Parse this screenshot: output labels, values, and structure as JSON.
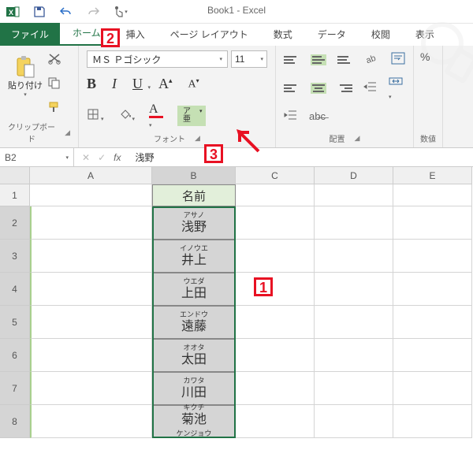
{
  "app": {
    "title": "Book1 - Excel"
  },
  "tabs": {
    "file": "ファイル",
    "home": "ホーム",
    "insert": "挿入",
    "pagelayout": "ページ レイアウト",
    "formulas": "数式",
    "data": "データ",
    "review": "校閲",
    "view": "表示"
  },
  "ribbon": {
    "clipboard": {
      "paste": "貼り付け",
      "label": "クリップボード"
    },
    "font": {
      "name": "ＭＳ Ｐゴシック",
      "size": "11",
      "bold": "B",
      "italic": "I",
      "underline": "U",
      "growA": "A",
      "shrinkA": "A",
      "colorA": "A",
      "phonetic": "ア\n亜",
      "label": "フォント"
    },
    "alignment": {
      "label": "配置"
    },
    "number": {
      "label": "数値",
      "pct": "%"
    }
  },
  "formula_bar": {
    "ref": "B2",
    "fx": "fx",
    "value": "浅野"
  },
  "columns": [
    "A",
    "B",
    "C",
    "D",
    "E"
  ],
  "rows": [
    {
      "n": "1",
      "h": 28,
      "b": {
        "header": true,
        "main": "名前"
      }
    },
    {
      "n": "2",
      "h": 42,
      "b": {
        "ruby": "アサノ",
        "main": "浅野"
      }
    },
    {
      "n": "3",
      "h": 42,
      "b": {
        "ruby": "イノウエ",
        "main": "井上"
      }
    },
    {
      "n": "4",
      "h": 42,
      "b": {
        "ruby": "ウエダ",
        "main": "上田"
      }
    },
    {
      "n": "5",
      "h": 42,
      "b": {
        "ruby": "エンドウ",
        "main": "遠藤"
      }
    },
    {
      "n": "6",
      "h": 42,
      "b": {
        "ruby": "オオタ",
        "main": "太田"
      }
    },
    {
      "n": "7",
      "h": 42,
      "b": {
        "ruby": "カワタ",
        "main": "川田"
      }
    },
    {
      "n": "8",
      "h": 42,
      "b": {
        "ruby": "キクチ",
        "main": "菊池"
      },
      "partial": {
        "ruby": "ケンジョウ"
      }
    }
  ],
  "callouts": {
    "c1": "1",
    "c2": "2",
    "c3": "3"
  }
}
